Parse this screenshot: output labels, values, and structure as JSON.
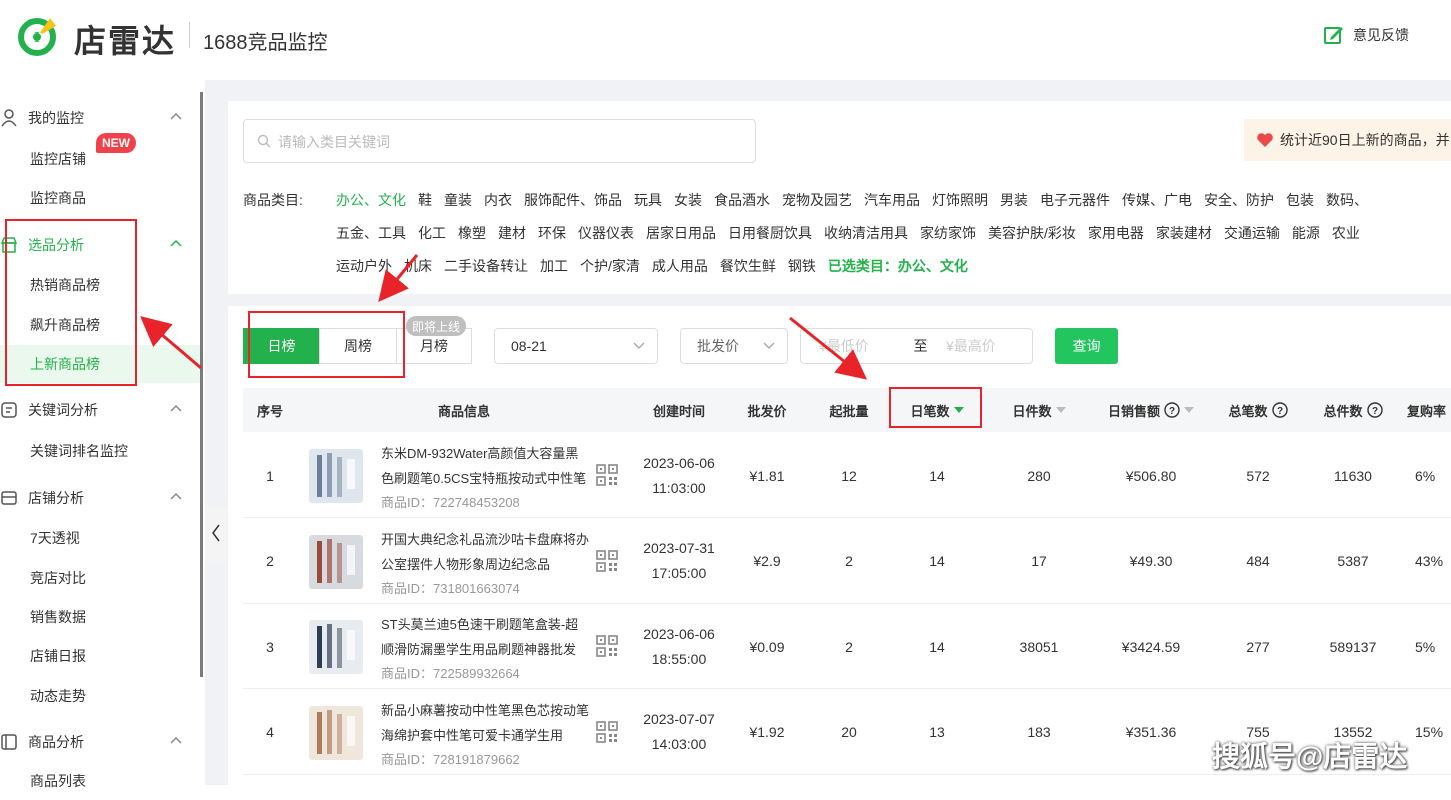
{
  "header": {
    "brand": "店雷达",
    "app_title": "1688竞品监控",
    "feedback": "意见反馈",
    "brand_color": "#22b14c"
  },
  "sidebar": {
    "groups": [
      {
        "label": "我的监控",
        "icon": "user-icon",
        "items": [
          "监控店铺",
          "监控商品"
        ]
      },
      {
        "label": "选品分析",
        "icon": "shop-icon",
        "badge": "NEW",
        "items": [
          "热销商品榜",
          "飙升商品榜",
          "上新商品榜"
        ],
        "active_item": "上新商品榜"
      },
      {
        "label": "关键词分析",
        "icon": "keyword-icon",
        "items": [
          "关键词排名监控"
        ]
      },
      {
        "label": "店铺分析",
        "icon": "store-icon",
        "items": [
          "7天透视",
          "竞店对比",
          "销售数据",
          "店铺日报",
          "动态走势"
        ]
      },
      {
        "label": "商品分析",
        "icon": "product-icon",
        "items": [
          "商品列表"
        ]
      }
    ]
  },
  "search": {
    "placeholder": "请输入类目关键词"
  },
  "promo": "统计近90日上新的商品，并",
  "categories": {
    "label": "商品类目:",
    "rows": [
      [
        "办公、文化",
        "鞋",
        "童装",
        "内衣",
        "服饰配件、饰品",
        "玩具",
        "女装",
        "食品酒水",
        "宠物及园艺",
        "汽车用品",
        "灯饰照明",
        "男装",
        "电子元器件",
        "传媒、广电",
        "安全、防护",
        "包装",
        "数码、"
      ],
      [
        "五金、工具",
        "化工",
        "橡塑",
        "建材",
        "环保",
        "仪器仪表",
        "居家日用品",
        "日用餐厨饮具",
        "收纳清洁用具",
        "家纺家饰",
        "美容护肤/彩妆",
        "家用电器",
        "家装建材",
        "交通运输",
        "能源",
        "农业"
      ],
      [
        "运动户外",
        "机床",
        "二手设备转让",
        "加工",
        "个护/家清",
        "成人用品",
        "餐饮生鲜",
        "钢铁"
      ]
    ],
    "selected": "办公、文化",
    "chosen_label": "已选类目：办公、文化"
  },
  "toolbar": {
    "tabs": [
      "日榜",
      "周榜",
      "月榜"
    ],
    "active_tab": "日榜",
    "soon_badge": "即将上线",
    "date": "08-21",
    "price_type": "批发价",
    "min_price_placeholder": "¥最低价",
    "range_sep": "至",
    "max_price_placeholder": "¥最高价",
    "query_label": "查询"
  },
  "table": {
    "columns": [
      "序号",
      "商品信息",
      "创建时间",
      "批发价",
      "起批量",
      "日笔数",
      "日件数",
      "日销售额",
      "总笔数",
      "总件数",
      "复购率"
    ],
    "sorted_by": "日笔数",
    "id_prefix": "商品ID：",
    "rows": [
      {
        "no": "1",
        "title": "东米DM-932Water高颜值大容量黑色刷题笔0.5CS宝特瓶按动式中性笔",
        "id": "722748453208",
        "date": "2023-06-06",
        "time": "11:03:00",
        "price": "¥1.81",
        "moq": "12",
        "daily_orders": "14",
        "daily_pieces": "280",
        "daily_sales": "¥506.80",
        "total_orders": "572",
        "total_pieces": "11630",
        "repurchase": "6%"
      },
      {
        "no": "2",
        "title": "开国大典纪念礼品流沙咕卡盘麻将办公室摆件人物形象周边纪念品",
        "id": "731801663074",
        "date": "2023-07-31",
        "time": "17:05:00",
        "price": "¥2.9",
        "moq": "2",
        "daily_orders": "14",
        "daily_pieces": "17",
        "daily_sales": "¥49.30",
        "total_orders": "484",
        "total_pieces": "5387",
        "repurchase": "43%"
      },
      {
        "no": "3",
        "title": "ST头莫兰迪5色速干刷题笔盒装-超顺滑防漏墨学生用品刷题神器批发",
        "id": "722589932664",
        "date": "2023-06-06",
        "time": "18:55:00",
        "price": "¥0.09",
        "moq": "2",
        "daily_orders": "14",
        "daily_pieces": "38051",
        "daily_sales": "¥3424.59",
        "total_orders": "277",
        "total_pieces": "589137",
        "repurchase": "5%"
      },
      {
        "no": "4",
        "title": "新品小麻薯按动中性笔黑色芯按动笔海绵护套中性笔可爱卡通学生用",
        "id": "728191879662",
        "date": "2023-07-07",
        "time": "14:03:00",
        "price": "¥1.92",
        "moq": "20",
        "daily_orders": "13",
        "daily_pieces": "183",
        "daily_sales": "¥351.36",
        "total_orders": "755",
        "total_pieces": "13552",
        "repurchase": "15%"
      }
    ]
  },
  "watermark": "搜狐号@店雷达"
}
